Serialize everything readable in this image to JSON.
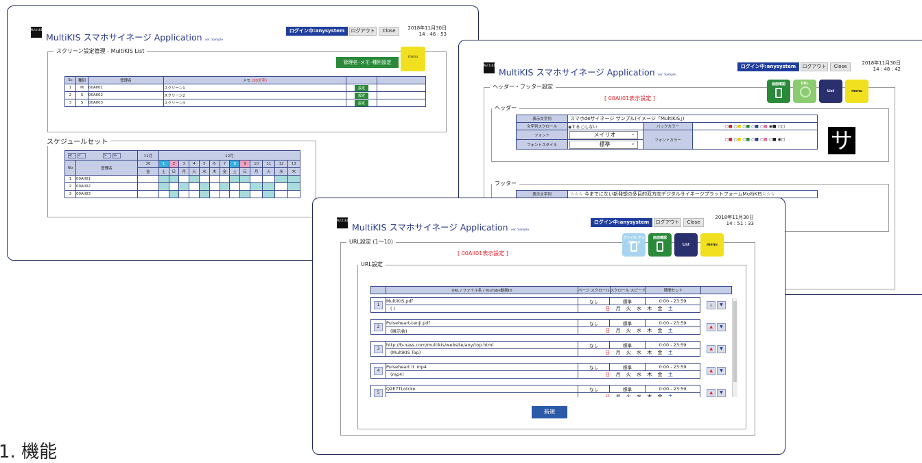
{
  "app": {
    "title": "MultiKIS スマホサイネージ Application",
    "ver": "ver. Sample",
    "logo_text": "MultiKIS",
    "user_btn": "ログイン中:anysystem",
    "logout_btn": "ログアウト",
    "close_btn": "Close",
    "date": "2018年11月30日"
  },
  "win1": {
    "time": "14 : 46 : 53",
    "legend": "スクリーン設定管理 - MultiKIS List",
    "group_btn": "管理名･メモ･種別設定",
    "menu_tile": "menu",
    "table_headers": [
      "Sc",
      "種別",
      "管理名",
      "メモ",
      "(30文字)"
    ],
    "rows": [
      {
        "sc": "1",
        "type": "M",
        "name": "00AII01",
        "memo": "スクリーン1",
        "btn": "設定"
      },
      {
        "sc": "2",
        "type": "S",
        "name": "00AII02",
        "memo": "スクリーン2",
        "btn": "設定"
      },
      {
        "sc": "3",
        "type": "S",
        "name": "00AII03",
        "memo": "スクリーン3",
        "btn": "設定"
      }
    ],
    "schedule_legend": "スケジュールセット",
    "nav": [
      "≪",
      "<",
      ">",
      "≫"
    ],
    "month11": "11月",
    "month12": "12月",
    "col_no": "No",
    "col_name": "管理名",
    "days": [
      "30",
      "1",
      "2",
      "3",
      "4",
      "5",
      "6",
      "7",
      "8",
      "9",
      "10",
      "11",
      "12",
      "13"
    ],
    "weekdays": [
      "金",
      "土",
      "日",
      "月",
      "火",
      "水",
      "木",
      "金",
      "土",
      "日",
      "月",
      "火",
      "水",
      "木"
    ],
    "sched_rows": [
      {
        "no": "1",
        "name": "00AII01"
      },
      {
        "no": "2",
        "name": "00AII02"
      },
      {
        "no": "3",
        "name": "00AII03"
      }
    ]
  },
  "win2": {
    "time": "14 : 48 : 42",
    "legend": "ヘッダー・フッター設定",
    "heading": "[ 00AII01表示設定 ]",
    "tile_labels": [
      "画面確認",
      "URL",
      "List",
      "menu"
    ],
    "header_legend": "ヘッダー",
    "footer_legend": "フッター",
    "label_text": "表示文字列",
    "header_text": "スマホdeサイネージ サンプル(イメージ「MultiKIS」)",
    "label_scroll": "文字列スクロール",
    "scroll_yes": "する",
    "scroll_no": "しない",
    "label_font": "フォント",
    "font_value": "メイリオ",
    "label_style": "フォントスタイル",
    "style_value": "標準",
    "label_bg": "バックカラー",
    "label_fc": "フォントカラー",
    "preview_char": "サ",
    "footer_text": "☆☆☆ 今までにない新発想の多目的双方向デジタルサイネージプラットフォームMultiKIS☆☆☆"
  },
  "win3": {
    "time": "14 : 51 : 33",
    "legend": "URL設定 (1〜10)",
    "heading": "[ 00AII01表示設定 ]",
    "tile_labels": [
      "ファイル アップロード",
      "画面確認",
      "List",
      "menu"
    ],
    "sub_legend": "URL設定",
    "col_url": "URL / ファイル名 / YouTube動画ID",
    "col_page": "ページ スクロール",
    "col_scroll": "スクロール スピード",
    "col_time": "時間セット",
    "rows": [
      {
        "no": "1",
        "url": "MultiKIS.pdf",
        "sub": "(                                              )",
        "page": "なし",
        "speed": "標準",
        "time": "0:00 - 23:59"
      },
      {
        "no": "2",
        "url": "Pulseheart-tenji.pdf",
        "sub": "(展示会)",
        "page": "なし",
        "speed": "標準",
        "time": "0:00 - 23:59"
      },
      {
        "no": "3",
        "url": "http://b-nass.com/multikis/website/any/top.html",
        "sub": "(MultiKIS Top)",
        "page": "なし",
        "speed": "標準",
        "time": "0:00 - 23:59"
      },
      {
        "no": "4",
        "url": "Pulseheart II .mp4",
        "sub": "(mp4)",
        "page": "なし",
        "speed": "標準",
        "time": "0:00 - 23:59"
      },
      {
        "no": "5",
        "url": "Q2E7TLotcko",
        "sub": "",
        "page": "なし",
        "speed": "標準",
        "time": "0:00 - 23:59"
      }
    ],
    "weekdays": [
      "日",
      "月",
      "火",
      "水",
      "木",
      "金",
      "土"
    ],
    "new_btn": "新規"
  },
  "footer_text": "1. 機能",
  "colors": {
    "accent": "#1f3d9c",
    "green": "#2a8a3a",
    "red": "#e0202a",
    "yellow": "#f0e020",
    "navy": "#2a2f6e"
  }
}
